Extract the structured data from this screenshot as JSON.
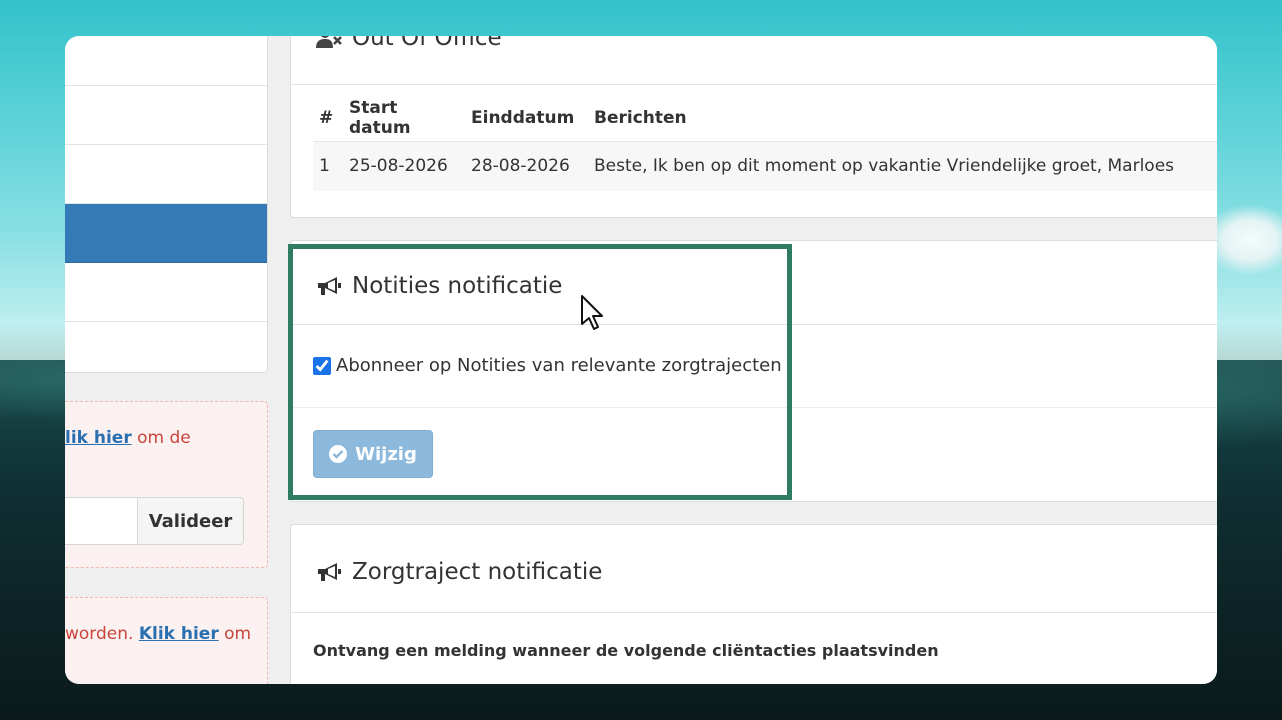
{
  "sidebar": {
    "items": [
      {
        "active": false
      },
      {
        "active": false
      },
      {
        "active": true
      },
      {
        "active": false
      },
      {
        "active": false
      }
    ]
  },
  "alerts": {
    "first": {
      "link": "lik hier",
      "text_after": " om de"
    },
    "validate_button": "Valideer",
    "second": {
      "text_before": "worden. ",
      "link": "Klik hier",
      "text_after": " om"
    }
  },
  "out_of_office": {
    "icon": "user-times-icon",
    "title": "Out Of Office",
    "columns": [
      "#",
      "Start datum",
      "Einddatum",
      "Berichten"
    ],
    "rows": [
      [
        "1",
        "25-08-2026",
        "28-08-2026",
        "Beste, Ik ben op dit moment op vakantie Vriendelijke groet, Marloes"
      ]
    ]
  },
  "notes_notification": {
    "icon": "bullhorn-icon",
    "title": "Notities notificatie",
    "checkbox_label": "Abonneer op Notities van relevante zorgtrajecten",
    "checkbox_checked": true,
    "button_label": "Wijzig"
  },
  "care_notification": {
    "icon": "bullhorn-icon",
    "title": "Zorgtraject notificatie",
    "description": "Ontvang een melding wanneer de volgende cliëntacties plaatsvinden"
  },
  "colors": {
    "accent": "#337ab7",
    "highlight": "#2e7d62",
    "alert_text": "#c9443a"
  }
}
